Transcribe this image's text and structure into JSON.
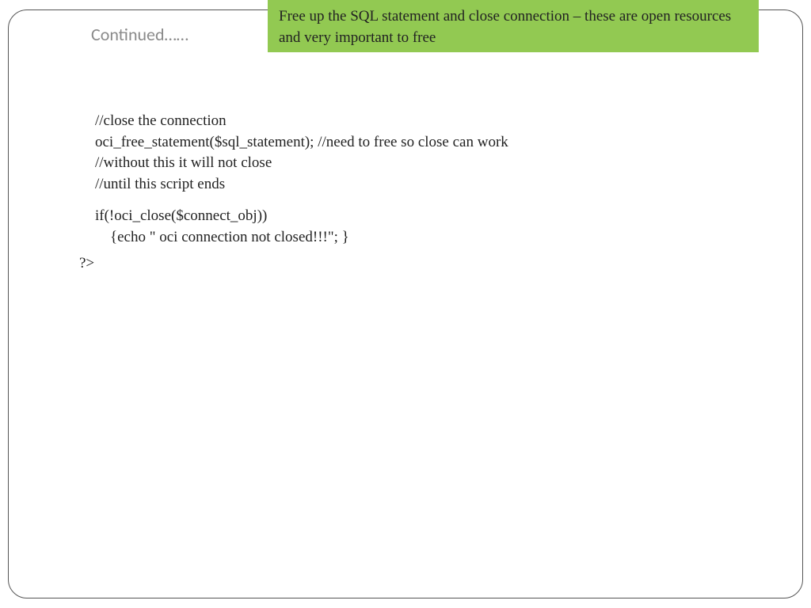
{
  "heading": "Continued……",
  "annotation": "Free up the SQL statement and close connection – these are open resources and very important to free",
  "code": {
    "line1": "//close the connection",
    "line2": "oci_free_statement($sql_statement); //need to free so close can work",
    "line3": "//without this it will not close",
    "line4": "//until this script ends",
    "line5": "if(!oci_close($connect_obj))",
    "line6": "    {echo \" oci connection not closed!!!\"; }",
    "line7": "?>"
  }
}
